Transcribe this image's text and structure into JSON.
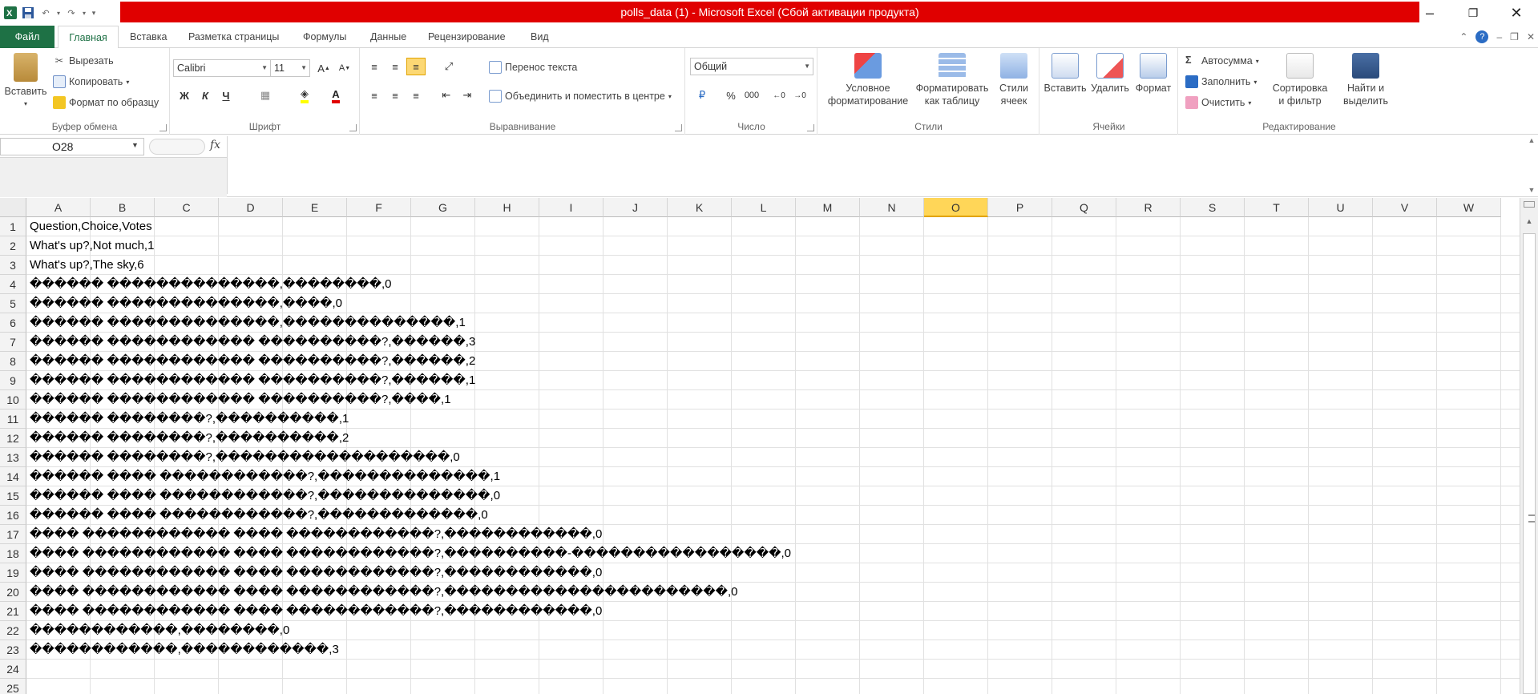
{
  "titlebar": {
    "title": "polls_data (1)  -  Microsoft Excel (Сбой активации продукта)",
    "title_bg": "#e00000"
  },
  "tabs": {
    "file": "Файл",
    "items": [
      "Главная",
      "Вставка",
      "Разметка страницы",
      "Формулы",
      "Данные",
      "Рецензирование",
      "Вид"
    ]
  },
  "ribbon": {
    "clipboard": {
      "paste": "Вставить",
      "cut": "Вырезать",
      "copy": "Копировать",
      "format_painter": "Формат по образцу",
      "label": "Буфер обмена"
    },
    "font": {
      "name": "Calibri",
      "size": "11",
      "bold": "Ж",
      "italic": "К",
      "underline": "Ч",
      "label": "Шрифт"
    },
    "alignment": {
      "wrap_text": "Перенос текста",
      "merge_center": "Объединить и поместить в центре",
      "label": "Выравнивание"
    },
    "number": {
      "format": "Общий",
      "percent": "%",
      "thousands": "000",
      "label": "Число"
    },
    "styles": {
      "conditional_line1": "Условное",
      "conditional_line2": "форматирование",
      "as_table_line1": "Форматировать",
      "as_table_line2": "как таблицу",
      "cell_styles_line1": "Стили",
      "cell_styles_line2": "ячеек",
      "label": "Стили"
    },
    "cells": {
      "insert": "Вставить",
      "delete": "Удалить",
      "format": "Формат",
      "label": "Ячейки"
    },
    "editing": {
      "autosum": "Автосумма",
      "fill": "Заполнить",
      "clear": "Очистить",
      "sort_line1": "Сортировка",
      "sort_line2": "и фильтр",
      "find_line1": "Найти и",
      "find_line2": "выделить",
      "label": "Редактирование"
    }
  },
  "formula_bar": {
    "name_box": "O28",
    "fx": "fx",
    "formula": ""
  },
  "grid": {
    "columns": [
      "A",
      "B",
      "C",
      "D",
      "E",
      "F",
      "G",
      "H",
      "I",
      "J",
      "K",
      "L",
      "M",
      "N",
      "O",
      "P",
      "Q",
      "R",
      "S",
      "T",
      "U",
      "V",
      "W"
    ],
    "selected_column": "O",
    "rows": [
      {
        "n": "1",
        "a": "Question,Choice,Votes"
      },
      {
        "n": "2",
        "a": "What's up?,Not much,1"
      },
      {
        "n": "3",
        "a": "What's up?,The sky,6"
      },
      {
        "n": "4",
        "a": "������ ��������������,��������,0"
      },
      {
        "n": "5",
        "a": "������ ��������������,����,0"
      },
      {
        "n": "6",
        "a": "������ ��������������,��������������,1"
      },
      {
        "n": "7",
        "a": "������ ������������ ����������?,������,3"
      },
      {
        "n": "8",
        "a": "������ ������������ ����������?,������,2"
      },
      {
        "n": "9",
        "a": "������ ������������ ����������?,������,1"
      },
      {
        "n": "10",
        "a": "������ ������������ ����������?,����,1"
      },
      {
        "n": "11",
        "a": "������ ��������?,����������,1"
      },
      {
        "n": "12",
        "a": "������ ��������?,����������,2"
      },
      {
        "n": "13",
        "a": "������ ��������?,�������������������,0"
      },
      {
        "n": "14",
        "a": "������ ���� ������������?,��������������,1"
      },
      {
        "n": "15",
        "a": "������ ���� ������������?,��������������,0"
      },
      {
        "n": "16",
        "a": "������ ���� ������������?,�������������,0"
      },
      {
        "n": "17",
        "a": "���� ������������ ���� ������������?,������������,0"
      },
      {
        "n": "18",
        "a": "���� ������������ ���� ������������?,����������-�����������������,0"
      },
      {
        "n": "19",
        "a": "���� ������������ ���� ������������?,������������,0"
      },
      {
        "n": "20",
        "a": "���� ������������ ���� ������������?,�����������������������,0"
      },
      {
        "n": "21",
        "a": "���� ������������ ���� ������������?,������������,0"
      },
      {
        "n": "22",
        "a": "������������,��������,0"
      },
      {
        "n": "23",
        "a": "������������,������������,3"
      },
      {
        "n": "24",
        "a": ""
      },
      {
        "n": "25",
        "a": ""
      }
    ]
  },
  "colors": {
    "excel_green": "#1e7145",
    "selected_header": "#ffd658"
  }
}
